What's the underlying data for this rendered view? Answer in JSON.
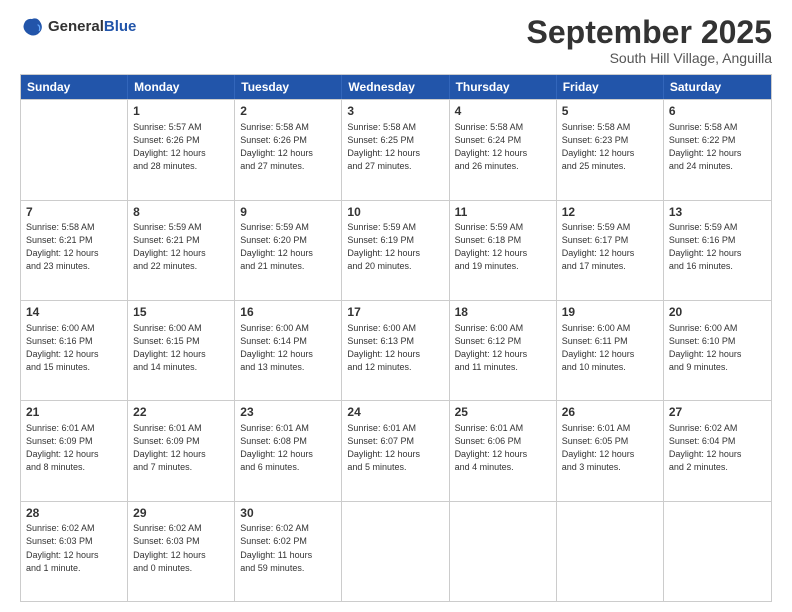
{
  "logo": {
    "general": "General",
    "blue": "Blue"
  },
  "header": {
    "month": "September 2025",
    "location": "South Hill Village, Anguilla"
  },
  "days_of_week": [
    "Sunday",
    "Monday",
    "Tuesday",
    "Wednesday",
    "Thursday",
    "Friday",
    "Saturday"
  ],
  "weeks": [
    [
      {
        "day": "",
        "info": ""
      },
      {
        "day": "1",
        "info": "Sunrise: 5:57 AM\nSunset: 6:26 PM\nDaylight: 12 hours\nand 28 minutes."
      },
      {
        "day": "2",
        "info": "Sunrise: 5:58 AM\nSunset: 6:26 PM\nDaylight: 12 hours\nand 27 minutes."
      },
      {
        "day": "3",
        "info": "Sunrise: 5:58 AM\nSunset: 6:25 PM\nDaylight: 12 hours\nand 27 minutes."
      },
      {
        "day": "4",
        "info": "Sunrise: 5:58 AM\nSunset: 6:24 PM\nDaylight: 12 hours\nand 26 minutes."
      },
      {
        "day": "5",
        "info": "Sunrise: 5:58 AM\nSunset: 6:23 PM\nDaylight: 12 hours\nand 25 minutes."
      },
      {
        "day": "6",
        "info": "Sunrise: 5:58 AM\nSunset: 6:22 PM\nDaylight: 12 hours\nand 24 minutes."
      }
    ],
    [
      {
        "day": "7",
        "info": "Sunrise: 5:58 AM\nSunset: 6:21 PM\nDaylight: 12 hours\nand 23 minutes."
      },
      {
        "day": "8",
        "info": "Sunrise: 5:59 AM\nSunset: 6:21 PM\nDaylight: 12 hours\nand 22 minutes."
      },
      {
        "day": "9",
        "info": "Sunrise: 5:59 AM\nSunset: 6:20 PM\nDaylight: 12 hours\nand 21 minutes."
      },
      {
        "day": "10",
        "info": "Sunrise: 5:59 AM\nSunset: 6:19 PM\nDaylight: 12 hours\nand 20 minutes."
      },
      {
        "day": "11",
        "info": "Sunrise: 5:59 AM\nSunset: 6:18 PM\nDaylight: 12 hours\nand 19 minutes."
      },
      {
        "day": "12",
        "info": "Sunrise: 5:59 AM\nSunset: 6:17 PM\nDaylight: 12 hours\nand 17 minutes."
      },
      {
        "day": "13",
        "info": "Sunrise: 5:59 AM\nSunset: 6:16 PM\nDaylight: 12 hours\nand 16 minutes."
      }
    ],
    [
      {
        "day": "14",
        "info": "Sunrise: 6:00 AM\nSunset: 6:16 PM\nDaylight: 12 hours\nand 15 minutes."
      },
      {
        "day": "15",
        "info": "Sunrise: 6:00 AM\nSunset: 6:15 PM\nDaylight: 12 hours\nand 14 minutes."
      },
      {
        "day": "16",
        "info": "Sunrise: 6:00 AM\nSunset: 6:14 PM\nDaylight: 12 hours\nand 13 minutes."
      },
      {
        "day": "17",
        "info": "Sunrise: 6:00 AM\nSunset: 6:13 PM\nDaylight: 12 hours\nand 12 minutes."
      },
      {
        "day": "18",
        "info": "Sunrise: 6:00 AM\nSunset: 6:12 PM\nDaylight: 12 hours\nand 11 minutes."
      },
      {
        "day": "19",
        "info": "Sunrise: 6:00 AM\nSunset: 6:11 PM\nDaylight: 12 hours\nand 10 minutes."
      },
      {
        "day": "20",
        "info": "Sunrise: 6:00 AM\nSunset: 6:10 PM\nDaylight: 12 hours\nand 9 minutes."
      }
    ],
    [
      {
        "day": "21",
        "info": "Sunrise: 6:01 AM\nSunset: 6:09 PM\nDaylight: 12 hours\nand 8 minutes."
      },
      {
        "day": "22",
        "info": "Sunrise: 6:01 AM\nSunset: 6:09 PM\nDaylight: 12 hours\nand 7 minutes."
      },
      {
        "day": "23",
        "info": "Sunrise: 6:01 AM\nSunset: 6:08 PM\nDaylight: 12 hours\nand 6 minutes."
      },
      {
        "day": "24",
        "info": "Sunrise: 6:01 AM\nSunset: 6:07 PM\nDaylight: 12 hours\nand 5 minutes."
      },
      {
        "day": "25",
        "info": "Sunrise: 6:01 AM\nSunset: 6:06 PM\nDaylight: 12 hours\nand 4 minutes."
      },
      {
        "day": "26",
        "info": "Sunrise: 6:01 AM\nSunset: 6:05 PM\nDaylight: 12 hours\nand 3 minutes."
      },
      {
        "day": "27",
        "info": "Sunrise: 6:02 AM\nSunset: 6:04 PM\nDaylight: 12 hours\nand 2 minutes."
      }
    ],
    [
      {
        "day": "28",
        "info": "Sunrise: 6:02 AM\nSunset: 6:03 PM\nDaylight: 12 hours\nand 1 minute."
      },
      {
        "day": "29",
        "info": "Sunrise: 6:02 AM\nSunset: 6:03 PM\nDaylight: 12 hours\nand 0 minutes."
      },
      {
        "day": "30",
        "info": "Sunrise: 6:02 AM\nSunset: 6:02 PM\nDaylight: 11 hours\nand 59 minutes."
      },
      {
        "day": "",
        "info": ""
      },
      {
        "day": "",
        "info": ""
      },
      {
        "day": "",
        "info": ""
      },
      {
        "day": "",
        "info": ""
      }
    ]
  ]
}
